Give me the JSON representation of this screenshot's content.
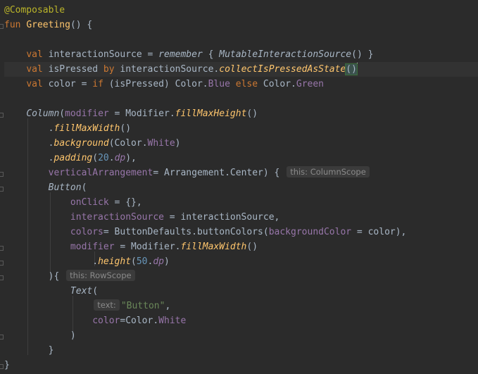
{
  "code": {
    "l1_annotation": "@Composable",
    "l2_fun": "fun",
    "l2_name": "Greeting",
    "l2_rest": "() {",
    "l4_val": "val",
    "l4_a": " interactionSource = ",
    "l4_remember": "remember",
    "l4_b": " { ",
    "l4_mis": "MutableInteractionSource",
    "l4_c": "() }",
    "l5_val": "val",
    "l5_a": " isPressed ",
    "l5_by": "by",
    "l5_b": " interactionSource.",
    "l5_fn": "collectIsPressedAsState",
    "l5_paren": "()",
    "l6_val": "val",
    "l6_a": " color = ",
    "l6_if": "if",
    "l6_b": " (isPressed) Color.",
    "l6_blue": "Blue",
    "l6_else": " else",
    "l6_c": " Color.",
    "l6_green": "Green",
    "l8_column": "Column",
    "l8_paren": "(",
    "l8_modifier": "modifier",
    "l8_a": " = Modifier.",
    "l8_fn": "fillMaxHeight",
    "l8_b": "()",
    "l9_a": ".",
    "l9_fn": "fillMaxWidth",
    "l9_b": "()",
    "l10_a": ".",
    "l10_fn": "background",
    "l10_b": "(Color.",
    "l10_white": "White",
    "l10_c": ")",
    "l11_a": ".",
    "l11_fn": "padding",
    "l11_b": "(",
    "l11_num": "20",
    "l11_c": ".",
    "l11_dp": "dp",
    "l11_d": "),",
    "l12_param": "verticalArrangement",
    "l12_a": "= Arrangement.Center) { ",
    "l12_hint": "this: ColumnScope",
    "l13_button": "Button",
    "l13_a": "(",
    "l14_param": "onClick",
    "l14_a": " = {},",
    "l15_param": "interactionSource",
    "l15_a": " = interactionSource,",
    "l16_param": "colors",
    "l16_a": "= ButtonDefaults.buttonColors(",
    "l16_param2": "backgroundColor",
    "l16_b": " = color),",
    "l17_param": "modifier",
    "l17_a": " = Modifier.",
    "l17_fn": "fillMaxWidth",
    "l17_b": "()",
    "l18_a": ".",
    "l18_fn": "height",
    "l18_b": "(",
    "l18_num": "50",
    "l18_c": ".",
    "l18_dp": "dp",
    "l18_d": ")",
    "l19_a": "){ ",
    "l19_hint": "this: RowScope",
    "l20_text": "Text",
    "l20_a": "(",
    "l21_hint": "text:",
    "l21_str": "\"Button\"",
    "l21_a": ",",
    "l22_param": "color",
    "l22_a": "=Color.",
    "l22_white": "White",
    "l23_a": ")",
    "l24_a": "}",
    "l25_a": "}"
  },
  "colors": {
    "background": "#2b2b2b",
    "current_line": "#323232",
    "keyword": "#cc7832",
    "annotation": "#bbb529",
    "function": "#ffc66d",
    "property": "#9876aa",
    "number": "#6897bb",
    "string": "#6a8759",
    "text": "#a9b7c6"
  }
}
